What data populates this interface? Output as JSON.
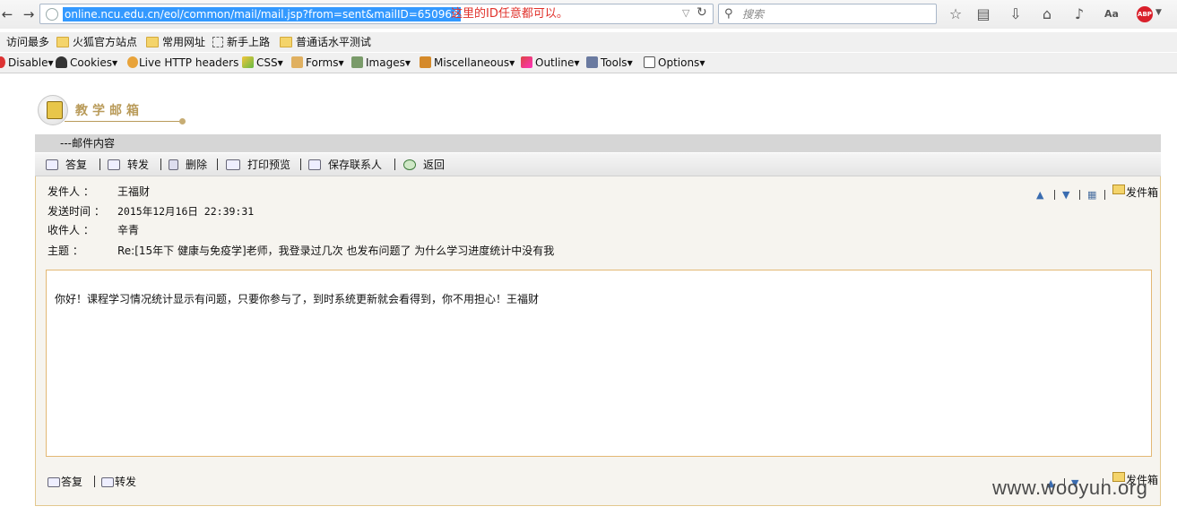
{
  "browser": {
    "url": "online.ncu.edu.cn/eol/common/mail/mail.jsp?from=sent&mailID=650964",
    "url_annotation": "这里的ID任意都可以。",
    "search_placeholder": "搜索",
    "bookmarks": [
      {
        "label": "访问最多"
      },
      {
        "label": "火狐官方站点"
      },
      {
        "label": "常用网址"
      },
      {
        "label": "新手上路"
      },
      {
        "label": "普通话水平测试"
      }
    ],
    "webdev_toolbar": [
      {
        "label": "Disable"
      },
      {
        "label": "Cookies"
      },
      {
        "label": "Live HTTP headers"
      },
      {
        "label": "CSS"
      },
      {
        "label": "Forms"
      },
      {
        "label": "Images"
      },
      {
        "label": "Miscellaneous"
      },
      {
        "label": "Outline"
      },
      {
        "label": "Tools"
      },
      {
        "label": "Options"
      }
    ]
  },
  "page": {
    "mailbox_title": "教学邮箱",
    "section_title": "---邮件内容",
    "toolbar": {
      "reply": "答复",
      "forward": "转发",
      "delete": "删除",
      "print_preview": "打印预览",
      "save_contact": "保存联系人",
      "back": "返回"
    },
    "mail": {
      "from_label": "发件人 ：",
      "from_value": "王福财",
      "time_label": "发送时间 ：",
      "time_value": "2015年12月16日 22:39:31",
      "to_label": "收件人 ：",
      "to_value": "辛青",
      "subject_label": "主题 ：",
      "subject_value": "Re:[15年下 健康与免疫学]老师，我登录过几次 也发布问题了 为什么学习进度统计中没有我",
      "body": "你好！课程学习情况统计显示有问题，只要你参与了，到时系统更新就会看得到，你不用担心！王福财"
    },
    "outbox_label": "发件箱",
    "footer": {
      "reply": "答复",
      "forward": "转发"
    }
  },
  "watermark": "www.wooyun.org"
}
